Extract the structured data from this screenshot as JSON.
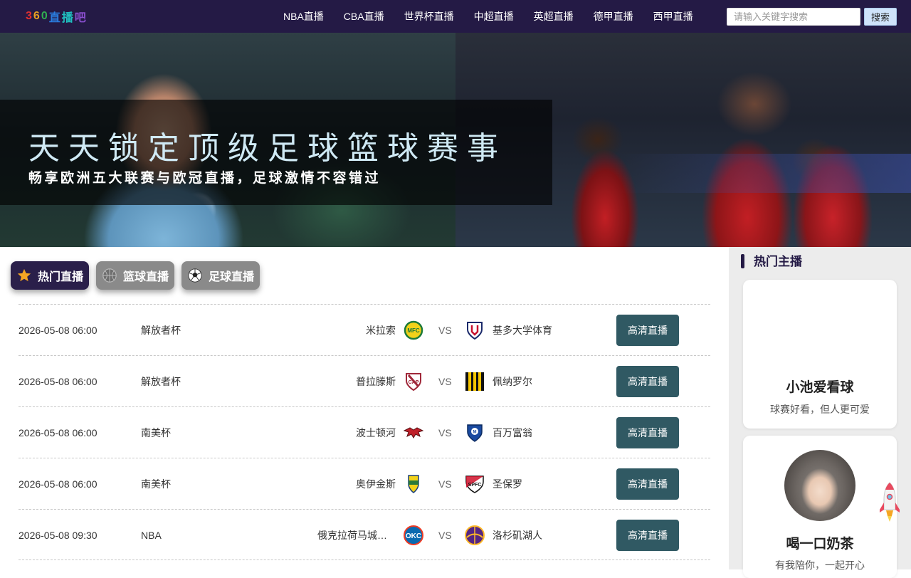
{
  "nav": {
    "logo": [
      "3",
      "6",
      "0",
      "直",
      "播",
      "吧"
    ],
    "logo_colors": [
      "#e03030",
      "#e8a020",
      "#30b050",
      "#2a7de0",
      "#20c0c0",
      "#8a4fd0"
    ],
    "links": [
      "NBA直播",
      "CBA直播",
      "世界杯直播",
      "中超直播",
      "英超直播",
      "德甲直播",
      "西甲直播"
    ],
    "search_placeholder": "请输入关键字搜索",
    "search_button": "搜索"
  },
  "banner": {
    "title": "天天锁定顶级足球篮球赛事",
    "subtitle": "畅享欧洲五大联赛与欧冠直播，足球激情不容错过"
  },
  "tabs": [
    {
      "label": "热门直播",
      "icon": "star-icon",
      "active": true
    },
    {
      "label": "篮球直播",
      "icon": "basketball-icon",
      "active": false
    },
    {
      "label": "足球直播",
      "icon": "soccer-ball-icon",
      "active": false
    }
  ],
  "matches": [
    {
      "time": "2026-05-08 06:00",
      "league": "解放者杯",
      "home": "米拉索",
      "vs": "VS",
      "away": "基多大学体育",
      "button": "高清直播",
      "home_color": "#f2d21a",
      "away_color": "#c8102e"
    },
    {
      "time": "2026-05-08 06:00",
      "league": "解放者杯",
      "home": "普拉滕斯",
      "vs": "VS",
      "away": "佩纳罗尔",
      "button": "高清直播",
      "home_color": "#a0283a",
      "away_color": "#f5c400"
    },
    {
      "time": "2026-05-08 06:00",
      "league": "南美杯",
      "home": "波士顿河",
      "vs": "VS",
      "away": "百万富翁",
      "button": "高清直播",
      "home_color": "#c0202a",
      "away_color": "#1a4aa0"
    },
    {
      "time": "2026-05-08 06:00",
      "league": "南美杯",
      "home": "奥伊金斯",
      "vs": "VS",
      "away": "圣保罗",
      "button": "高清直播",
      "home_color": "#2a7a3a",
      "away_color": "#d0102a"
    },
    {
      "time": "2026-05-08 09:30",
      "league": "NBA",
      "home": "俄克拉荷马城雷霆",
      "vs": "VS",
      "away": "洛杉矶湖人",
      "button": "高清直播",
      "home_color": "#0a6ab0",
      "away_color": "#552583"
    }
  ],
  "sidebar": {
    "title": "热门主播",
    "anchors": [
      {
        "name": "小池爱看球",
        "desc": "球赛好看，但人更可爱"
      },
      {
        "name": "喝一口奶茶",
        "desc": "有我陪你，一起开心"
      }
    ]
  }
}
